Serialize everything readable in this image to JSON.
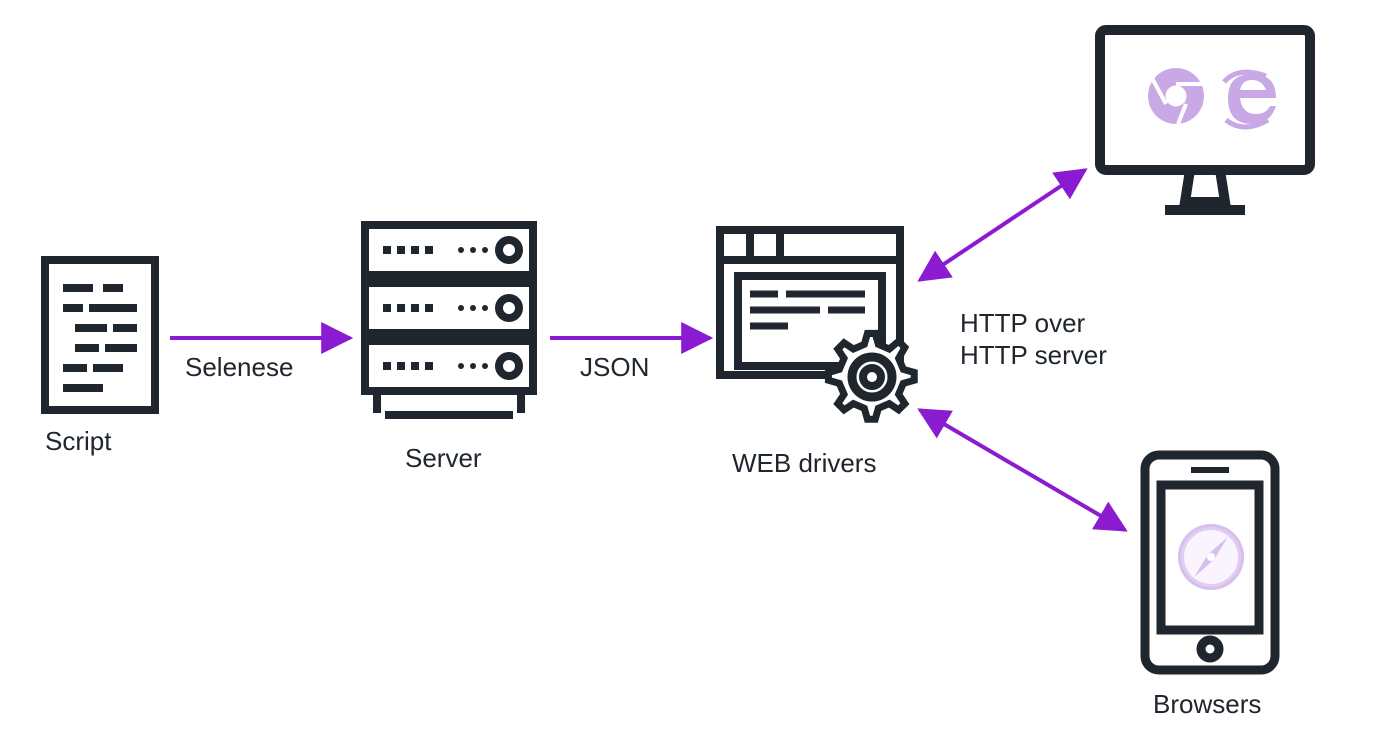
{
  "colors": {
    "ink": "#20262e",
    "arrow": "#8b1bd1",
    "browser_tint": "#c9a8e6"
  },
  "nodes": {
    "script": {
      "label": "Script"
    },
    "server": {
      "label": "Server"
    },
    "drivers": {
      "label": "WEB drivers"
    },
    "browsers": {
      "label": "Browsers"
    }
  },
  "edges": {
    "script_to_server": {
      "label": "Selenese"
    },
    "server_to_drivers": {
      "label": "JSON"
    },
    "drivers_to_browsers": {
      "label_line1": "HTTP over",
      "label_line2": "HTTP server"
    }
  }
}
